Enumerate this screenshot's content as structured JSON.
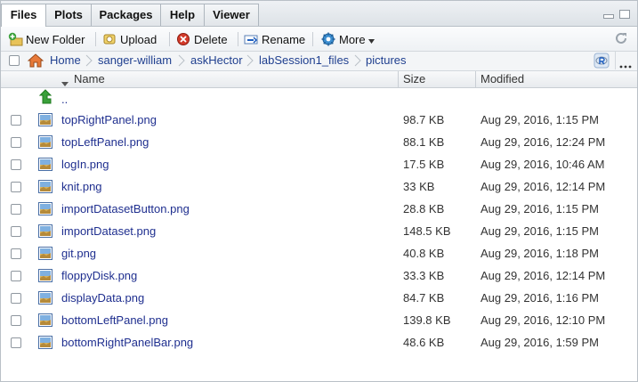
{
  "tabs": [
    "Files",
    "Plots",
    "Packages",
    "Help",
    "Viewer"
  ],
  "toolbar": {
    "new_folder": "New Folder",
    "upload": "Upload",
    "delete": "Delete",
    "rename": "Rename",
    "more": "More"
  },
  "breadcrumb": [
    "Home",
    "sanger-william",
    "askHector",
    "labSession1_files",
    "pictures"
  ],
  "table": {
    "col_name": "Name",
    "col_size": "Size",
    "col_modified": "Modified",
    "parent_label": "..",
    "files": [
      {
        "name": "topRightPanel.png",
        "size": "98.7 KB",
        "modified": "Aug 29, 2016, 1:15 PM"
      },
      {
        "name": "topLeftPanel.png",
        "size": "88.1 KB",
        "modified": "Aug 29, 2016, 12:24 PM"
      },
      {
        "name": "logIn.png",
        "size": "17.5 KB",
        "modified": "Aug 29, 2016, 10:46 AM"
      },
      {
        "name": "knit.png",
        "size": "33 KB",
        "modified": "Aug 29, 2016, 12:14 PM"
      },
      {
        "name": "importDatasetButton.png",
        "size": "28.8 KB",
        "modified": "Aug 29, 2016, 1:15 PM"
      },
      {
        "name": "importDataset.png",
        "size": "148.5 KB",
        "modified": "Aug 29, 2016, 1:15 PM"
      },
      {
        "name": "git.png",
        "size": "40.8 KB",
        "modified": "Aug 29, 2016, 1:18 PM"
      },
      {
        "name": "floppyDisk.png",
        "size": "33.3 KB",
        "modified": "Aug 29, 2016, 12:14 PM"
      },
      {
        "name": "displayData.png",
        "size": "84.7 KB",
        "modified": "Aug 29, 2016, 1:16 PM"
      },
      {
        "name": "bottomLeftPanel.png",
        "size": "139.8 KB",
        "modified": "Aug 29, 2016, 12:10 PM"
      },
      {
        "name": "bottomRightPanelBar.png",
        "size": "48.6 KB",
        "modified": "Aug 29, 2016, 1:59 PM"
      }
    ]
  },
  "colors": {
    "link": "#1f2f8f",
    "accent_green": "#3aa03a",
    "delete_red": "#c0392b"
  }
}
